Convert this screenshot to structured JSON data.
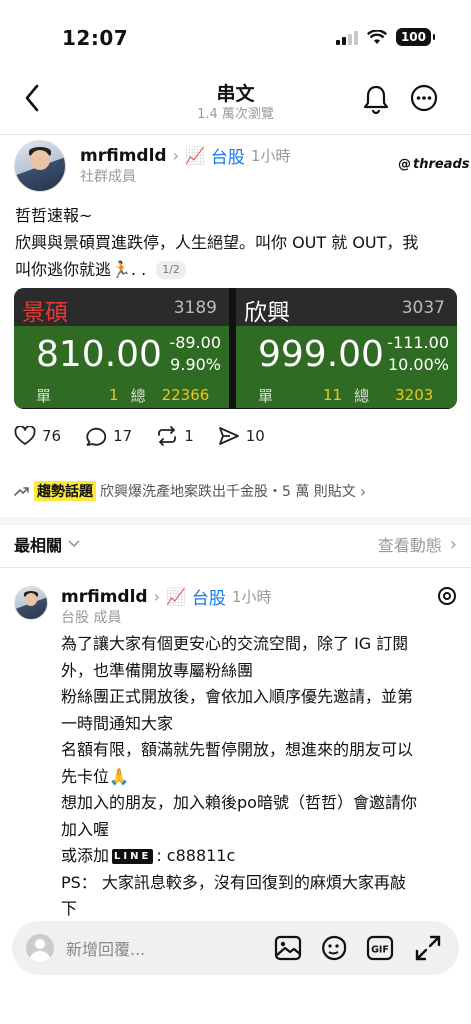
{
  "status_bar": {
    "time": "12:07",
    "battery": "100"
  },
  "nav": {
    "title": "串文",
    "subtitle": "1.4 萬次瀏覽"
  },
  "post": {
    "username": "mrfimdld",
    "tag_emoji": "📈",
    "tag": "台股",
    "time": "1小時",
    "role": "社群成員",
    "threads_logo": "threads",
    "lines": [
      "哲哲速報~",
      "欣興與景碩買進跌停，人生絕望。叫你 OUT 就 OUT，我",
      "叫你逃你就逃🏃.  ."
    ],
    "page_indicator": "1/2",
    "quotes": [
      {
        "name": "景碩",
        "code": "3189",
        "price": "810.00",
        "change": "-89.00",
        "pct": "9.90%",
        "single_label": "單",
        "single": "1",
        "total_label": "總",
        "total": "22366",
        "name_color": "#e53935"
      },
      {
        "name": "欣興",
        "code": "3037",
        "price": "999.00",
        "change": "-111.00",
        "pct": "10.00%",
        "single_label": "單",
        "single": "11",
        "total_label": "總",
        "total": "3203",
        "name_color": "#ffffff"
      }
    ],
    "actions": {
      "likes": "76",
      "comments": "17",
      "reposts": "1",
      "shares": "10"
    }
  },
  "trending": {
    "badge": "趨勢話題",
    "text": "欣興爆洗產地案跌出千金股・5 萬 則貼文"
  },
  "sort": {
    "label": "最相關",
    "activity": "查看動態"
  },
  "reply": {
    "username": "mrfimdld",
    "tag_emoji": "📈",
    "tag": "台股",
    "time": "1小時",
    "role": "台股 成員",
    "lines": [
      "為了讓大家有個更安心的交流空間，除了 IG 訂閱",
      "外，也準備開放專屬粉絲團",
      "粉絲團正式開放後，會依加入順序優先邀請，並第",
      "一時間通知大家",
      "名額有限，額滿就先暫停開放，想進來的朋友可以",
      "先卡位🙏",
      "想加入的朋友，加入賴後po暗號（哲哲）會邀請你",
      "加入喔",
      "PS：  大家訊息較多，沒有回復到的麻煩大家再敲",
      "下"
    ],
    "line_prefix": "或添加",
    "line_badge": "LINE",
    "line_id": ": c88811c"
  },
  "composer": {
    "placeholder": "新增回覆..."
  }
}
